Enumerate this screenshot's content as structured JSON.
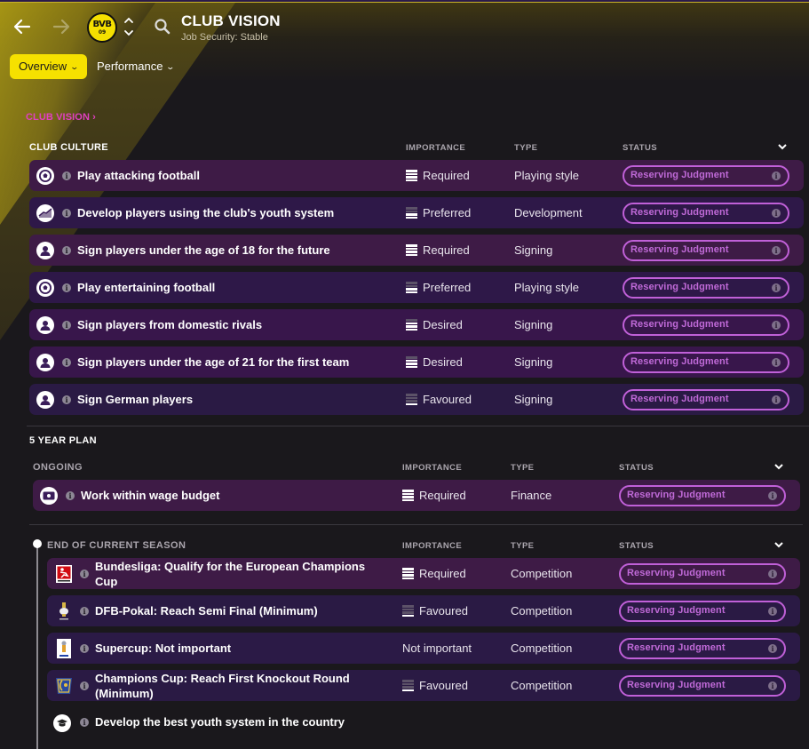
{
  "header": {
    "title": "CLUB VISION",
    "subtitle": "Job Security: Stable",
    "back_icon": "arrow-left-icon",
    "forward_icon": "arrow-right-icon",
    "club_badge": {
      "top": "BVB",
      "bottom": "09"
    },
    "search_icon": "search-icon"
  },
  "tabs": [
    {
      "label": "Overview",
      "active": true
    },
    {
      "label": "Performance",
      "active": false
    }
  ],
  "breadcrumb": "CLUB VISION",
  "colors": {
    "accent_yellow": "#f6e100",
    "breadcrumb_magenta": "#e040c0",
    "status_purple": "#c060d8"
  },
  "club_culture": {
    "title": "CLUB CULTURE",
    "columns": {
      "importance": "IMPORTANCE",
      "type": "TYPE",
      "status": "STATUS"
    },
    "rows": [
      {
        "icon": "football-icon",
        "text": "Play attacking football",
        "importance": "Required",
        "level": 4,
        "type": "Playing style",
        "status": "Reserving Judgment"
      },
      {
        "icon": "development-chart-icon",
        "text": "Develop players using the club's youth system",
        "importance": "Preferred",
        "level": 2,
        "type": "Development",
        "status": "Reserving Judgment"
      },
      {
        "icon": "person-icon",
        "text": "Sign players under the age of 18 for the future",
        "importance": "Required",
        "level": 4,
        "type": "Signing",
        "status": "Reserving Judgment"
      },
      {
        "icon": "football-icon",
        "text": "Play entertaining football",
        "importance": "Preferred",
        "level": 2,
        "type": "Playing style",
        "status": "Reserving Judgment"
      },
      {
        "icon": "person-icon",
        "text": "Sign players from domestic rivals",
        "importance": "Desired",
        "level": 3,
        "type": "Signing",
        "status": "Reserving Judgment"
      },
      {
        "icon": "person-icon",
        "text": "Sign players under the age of 21 for the first team",
        "importance": "Desired",
        "level": 3,
        "type": "Signing",
        "status": "Reserving Judgment"
      },
      {
        "icon": "person-icon",
        "text": "Sign German players",
        "importance": "Favoured",
        "level": 1,
        "type": "Signing",
        "status": "Reserving Judgment"
      }
    ]
  },
  "five_year_plan": {
    "title": "5 YEAR PLAN",
    "ongoing": {
      "title": "ONGOING",
      "columns": {
        "importance": "IMPORTANCE",
        "type": "TYPE",
        "status": "STATUS"
      },
      "rows": [
        {
          "icon": "money-icon",
          "text": "Work within wage budget",
          "importance": "Required",
          "level": 4,
          "type": "Finance",
          "status": "Reserving Judgment"
        }
      ]
    },
    "end_of_season": {
      "title": "END OF CURRENT SEASON",
      "columns": {
        "importance": "IMPORTANCE",
        "type": "TYPE",
        "status": "STATUS"
      },
      "rows": [
        {
          "icon": "bundesliga-logo-icon",
          "text_line1": "Bundesliga: Qualify for the European Champions",
          "text_line2": "Cup",
          "importance": "Required",
          "level": 4,
          "type": "Competition",
          "status": "Reserving Judgment"
        },
        {
          "icon": "dfb-pokal-trophy-icon",
          "text_line1": "DFB-Pokal: Reach Semi Final (Minimum)",
          "text_line2": "",
          "importance": "Favoured",
          "level": 1,
          "type": "Competition",
          "status": "Reserving Judgment"
        },
        {
          "icon": "supercup-trophy-icon",
          "text_line1": "Supercup: Not important",
          "text_line2": "",
          "importance": "Not important",
          "level": 0,
          "type": "Competition",
          "status": "Reserving Judgment"
        },
        {
          "icon": "champions-cup-logo-icon",
          "text_line1": "Champions Cup: Reach First Knockout Round",
          "text_line2": "(Minimum)",
          "importance": "Favoured",
          "level": 1,
          "type": "Competition",
          "status": "Reserving Judgment"
        }
      ]
    },
    "extra_row": {
      "icon": "graduation-cap-icon",
      "text": "Develop the best youth system in the country"
    }
  }
}
